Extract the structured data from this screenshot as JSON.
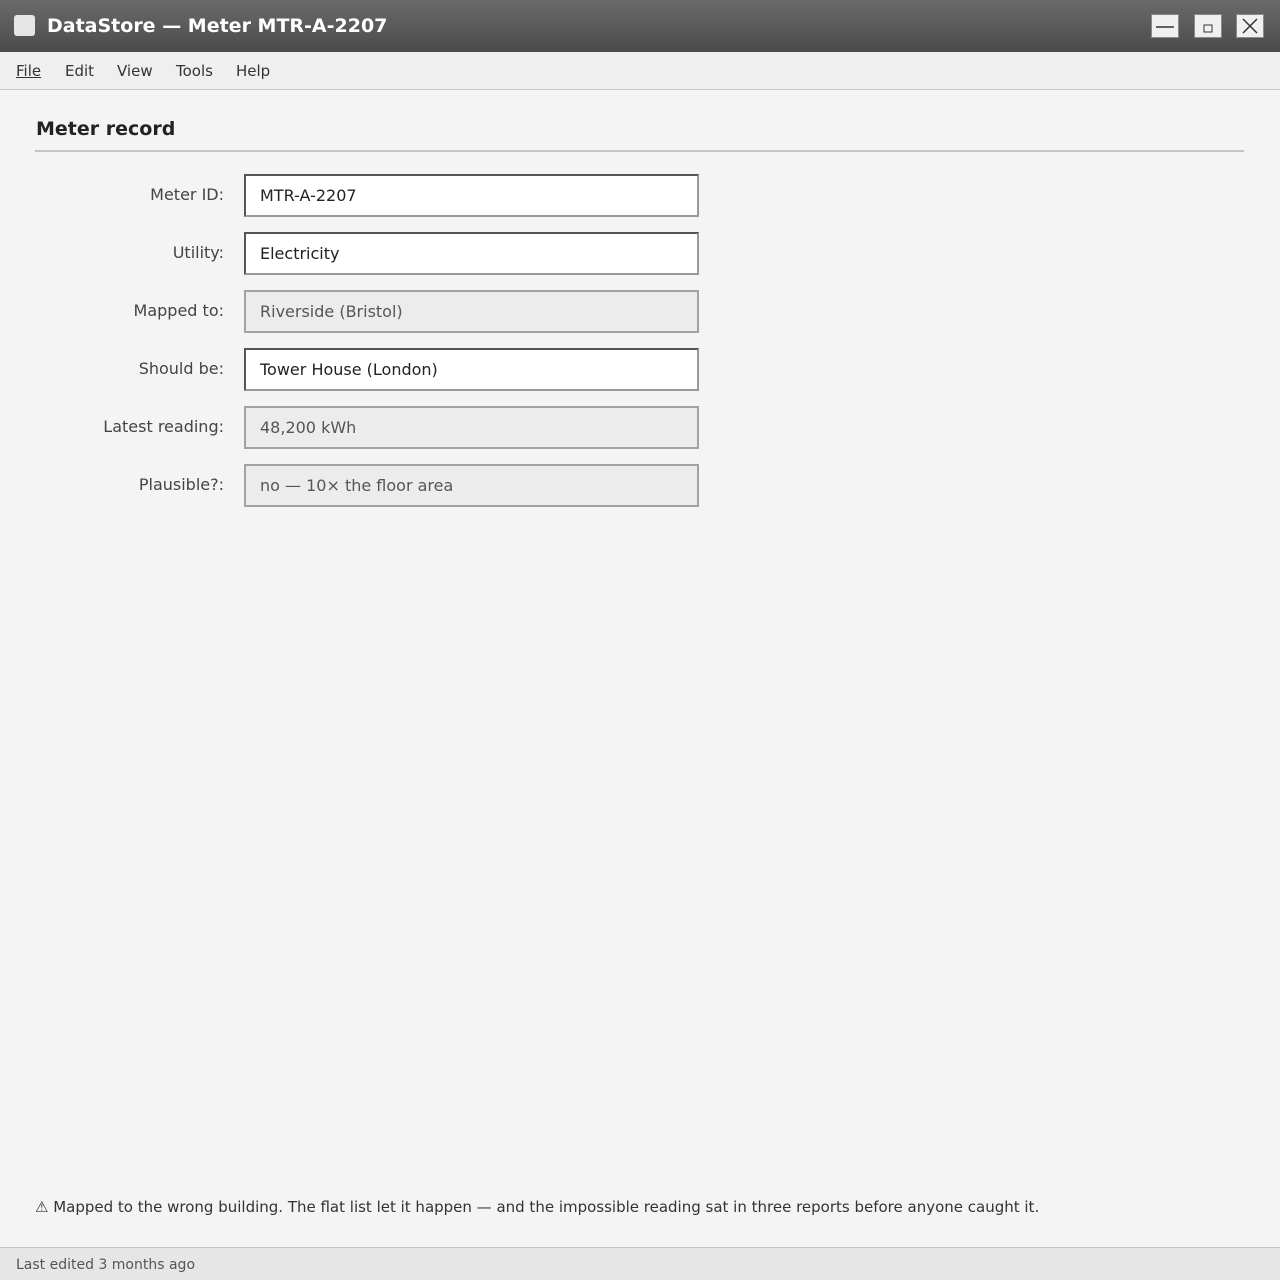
{
  "window": {
    "title": "DataStore — Meter MTR-A-2207",
    "icons": {
      "app": "app-icon",
      "minimize": "minimize-icon",
      "maximize": "maximize-icon",
      "close": "close-icon"
    }
  },
  "menu": {
    "items": [
      "File",
      "Edit",
      "View",
      "Tools",
      "Help"
    ]
  },
  "section": {
    "title": "Meter record"
  },
  "fields": [
    {
      "label": "Meter ID:",
      "value": "MTR-A-2207",
      "editable": true
    },
    {
      "label": "Utility:",
      "value": "Electricity",
      "editable": true
    },
    {
      "label": "Mapped to:",
      "value": "Riverside (Bristol)",
      "editable": false
    },
    {
      "label": "Should be:",
      "value": "Tower House (London)",
      "editable": true
    },
    {
      "label": "Latest reading:",
      "value": "48,200 kWh",
      "editable": false
    },
    {
      "label": "Plausible?:",
      "value": "no — 10× the floor area",
      "editable": false
    }
  ],
  "warning": {
    "icon": "warning-icon",
    "text": "⚠ Mapped to the wrong building. The flat list let it happen — and the impossible reading sat in three reports before anyone caught it."
  },
  "status": {
    "text": "Last edited 3 months ago"
  }
}
